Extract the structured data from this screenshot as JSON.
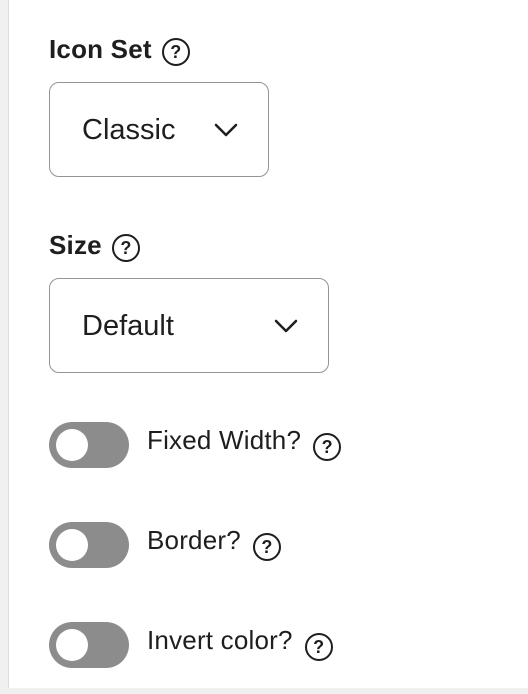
{
  "icon_set": {
    "label": "Icon Set",
    "help": "?",
    "selected": "Classic"
  },
  "size": {
    "label": "Size",
    "help": "?",
    "selected": "Default"
  },
  "toggles": [
    {
      "label": "Fixed Width?",
      "help": "?",
      "checked": false
    },
    {
      "label": "Border?",
      "help": "?",
      "checked": false
    },
    {
      "label": "Invert color?",
      "help": "?",
      "checked": false
    }
  ],
  "colors": {
    "toggle_off": "#8c8c8c",
    "border": "#949494",
    "text": "#1e1e1e"
  },
  "icons": {
    "help": "question-circle-icon",
    "dropdown": "chevron-down-icon"
  }
}
